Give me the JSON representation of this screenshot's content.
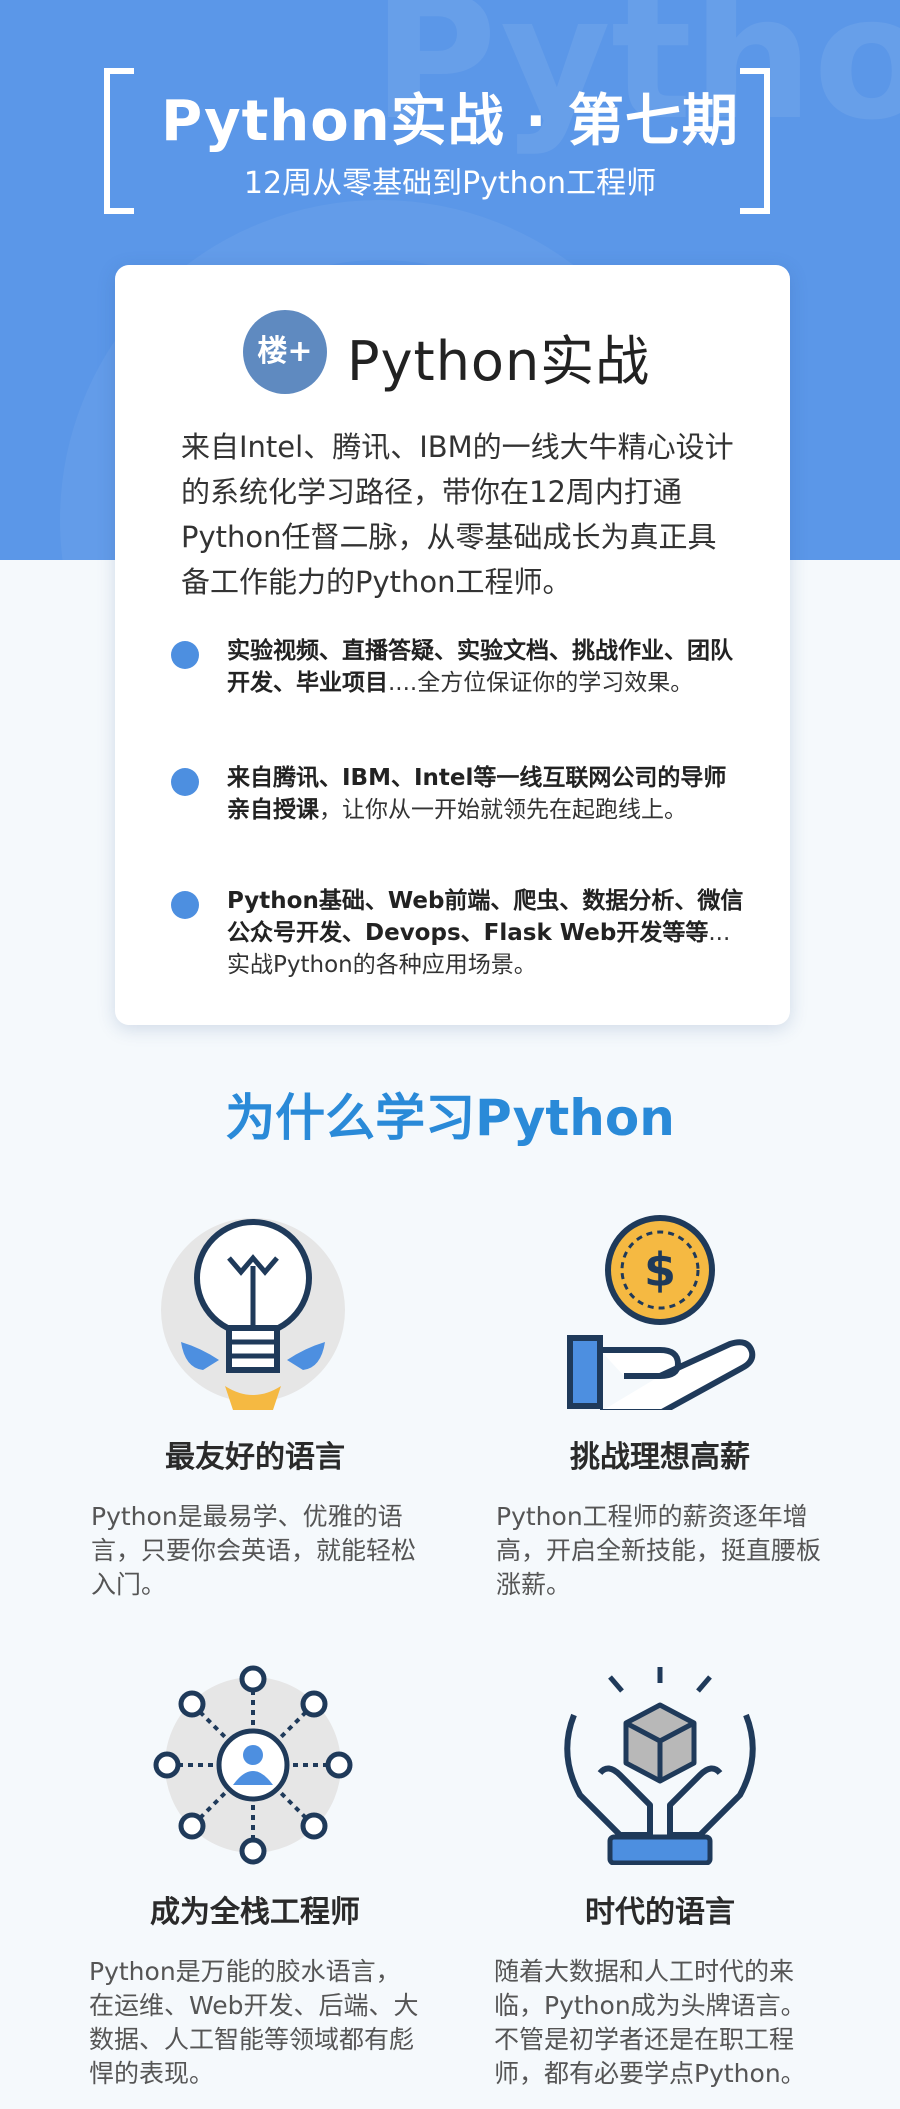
{
  "header": {
    "title": "Python实战 · 第七期",
    "subtitle": "12周从零基础到Python工程师",
    "watermark": "Pytho"
  },
  "card": {
    "logo_glyph": "楼+",
    "logo_text": "Python实战",
    "intro": "来自Intel、腾讯、IBM的一线大牛精心设计的系统化学习路径，带你在12周内打通Python任督二脉，从零基础成长为真正具备工作能力的Python工程师。",
    "bullets": [
      {
        "bold": "实验视频、直播答疑、实验文档、挑战作业、团队开发、毕业项目",
        "rest": "....全方位保证你的学习效果。"
      },
      {
        "bold": "来自腾讯、IBM、Intel等一线互联网公司的导师亲自授课",
        "rest": "，让你从一开始就领先在起跑线上。"
      },
      {
        "bold": "Python基础、Web前端、爬虫、数据分析、微信公众号开发、Devops、Flask Web开发等等",
        "rest": "...实战Python的各种应用场景。"
      }
    ]
  },
  "why": {
    "title": "为什么学习Python",
    "features": [
      {
        "icon": "lightbulb-rocket-icon",
        "title": "最友好的语言",
        "desc": "Python是最易学、优雅的语言，只要你会英语，就能轻松入门。"
      },
      {
        "icon": "hand-coin-icon",
        "title": "挑战理想高薪",
        "desc": "Python工程师的薪资逐年增高，开启全新技能，挺直腰板涨薪。"
      },
      {
        "icon": "network-user-icon",
        "title": "成为全栈工程师",
        "desc": "Python是万能的胶水语言，在运维、Web开发、后端、大数据、人工智能等领域都有彪悍的表现。"
      },
      {
        "icon": "hands-cube-icon",
        "title": "时代的语言",
        "desc": "随着大数据和人工时代的来临，Python成为头牌语言。不管是初学者还是在职工程师，都有必要学点Python。"
      }
    ]
  },
  "colors": {
    "hero_blue": "#5b97e8",
    "section_title_blue": "#2a8ad8",
    "bullet_blue": "#4d8fe0",
    "icon_navy": "#1f3a5a",
    "icon_gold": "#f5b942"
  }
}
